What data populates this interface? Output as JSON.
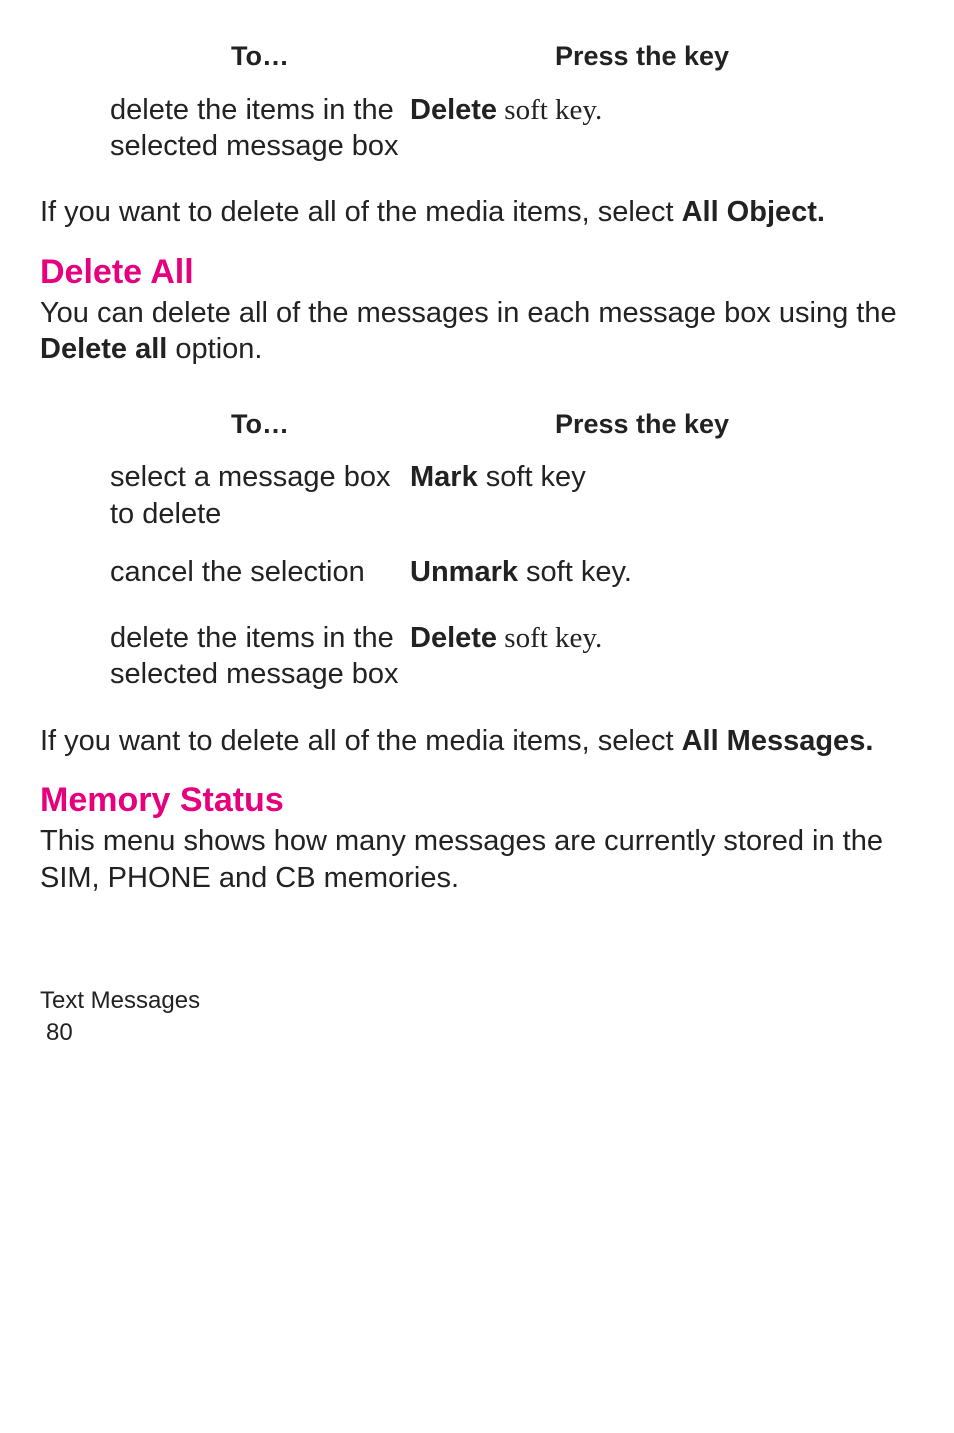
{
  "table1": {
    "head_to": "To…",
    "head_press": "Press the key",
    "row1_to": "delete the items in the selected message box",
    "row1_key_bold": "Delete",
    "row1_key_rest": " soft key."
  },
  "para1_a": "If you want to delete all of the media items, select ",
  "para1_b": "All Object.",
  "heading1": "Delete All",
  "para2_a": "You can delete all of the messages in each message box using the ",
  "para2_b": "Delete all",
  "para2_c": " option.",
  "table2": {
    "head_to": "To…",
    "head_press": "Press the key",
    "row1_to": "select a message box to delete",
    "row1_key_bold": "Mark",
    "row1_key_rest": " soft key",
    "row2_to": "cancel the selection",
    "row2_key_bold": "Unmark",
    "row2_key_rest": " soft key.",
    "row3_to": "delete the items in the selected message box",
    "row3_key_bold": "Delete",
    "row3_key_rest": " soft key."
  },
  "para3_a": "If you want to delete all of the media items, select ",
  "para3_b": "All Messages.",
  "heading2": "Memory Status",
  "para4": "This menu shows how many messages are currently stored in the SIM, PHONE and CB memories.",
  "footer": "Text Messages",
  "page": "80"
}
